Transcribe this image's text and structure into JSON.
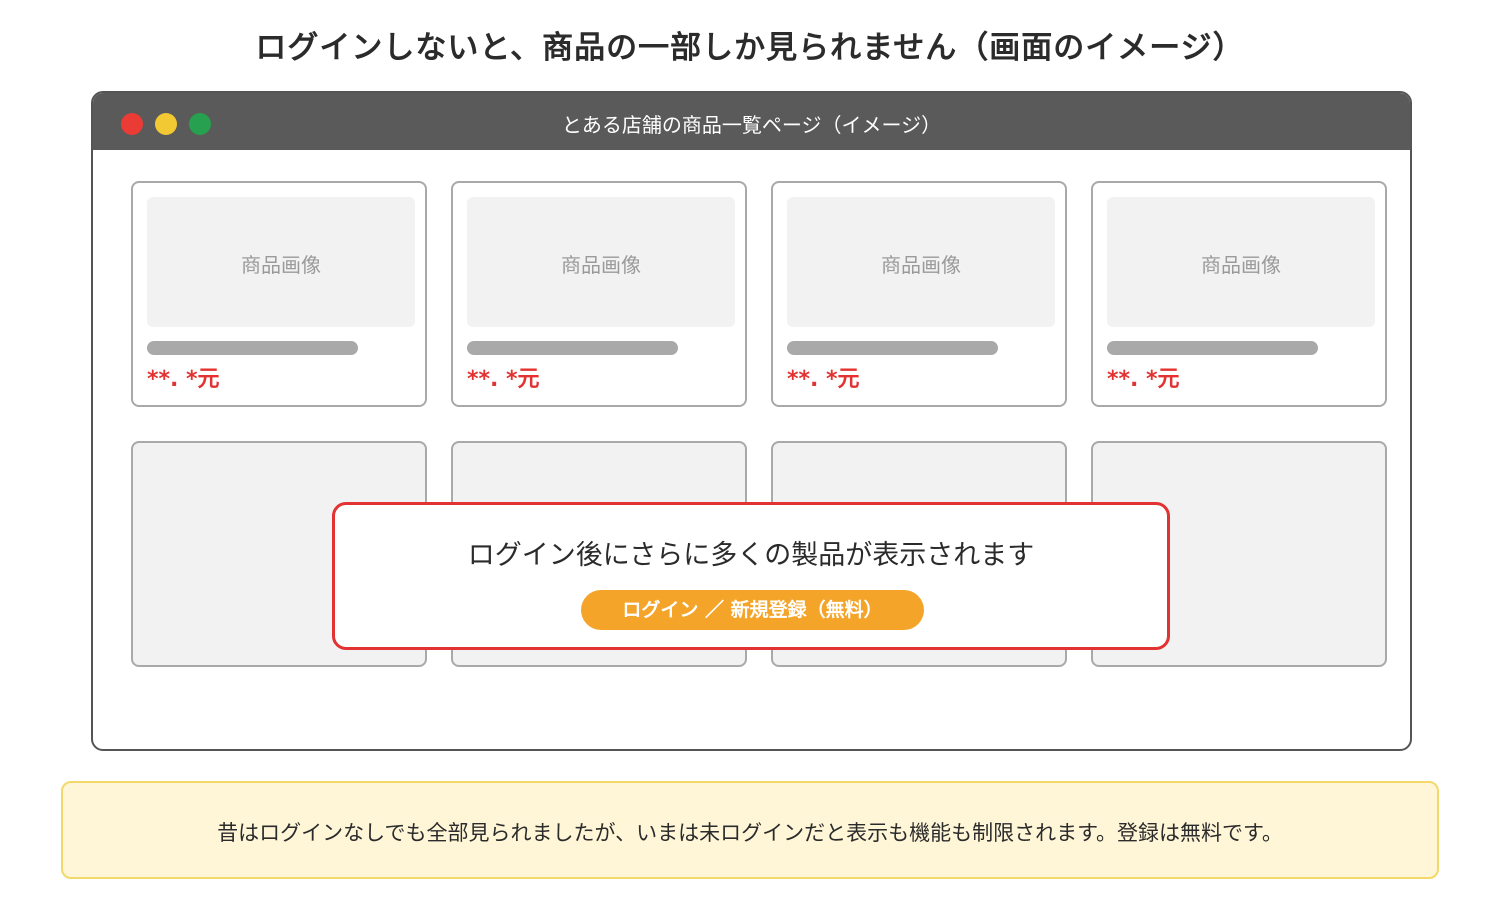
{
  "headline": "ログインしないと、商品の一部しか見られません（画面のイメージ）",
  "window": {
    "title": "とある店舗の商品一覧ページ（イメージ）"
  },
  "products": [
    {
      "image_label": "商品画像",
      "price": "**. *元"
    },
    {
      "image_label": "商品画像",
      "price": "**. *元"
    },
    {
      "image_label": "商品画像",
      "price": "**. *元"
    },
    {
      "image_label": "商品画像",
      "price": "**. *元"
    }
  ],
  "login_prompt": {
    "message": "ログイン後にさらに多くの製品が表示されます",
    "button_label": "ログイン ／ 新規登録（無料）"
  },
  "note": "昔はログインなしでも全部見られましたが、いまは未ログインだと表示も機能も制限されます。登録は無料です。",
  "colors": {
    "titlebar": "#5a5a5a",
    "price": "#e23232",
    "login_border": "#e23232",
    "login_button": "#f4a428",
    "note_background": "#fff6d8",
    "note_border": "#f3d96a"
  }
}
